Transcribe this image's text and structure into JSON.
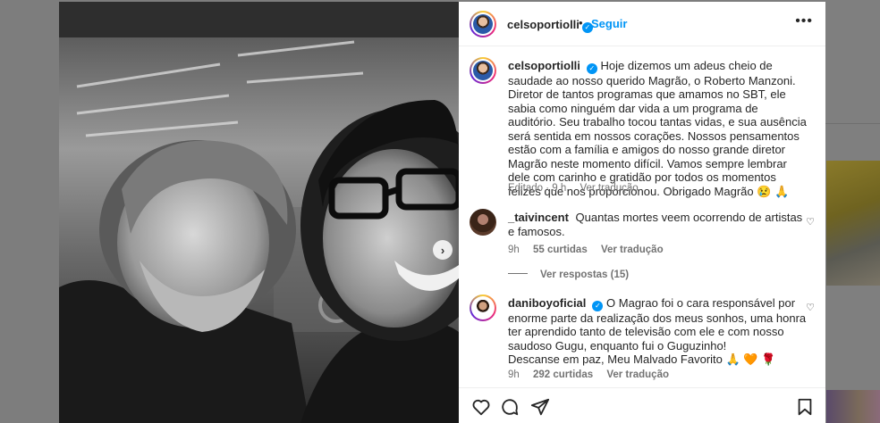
{
  "post": {
    "author": "celsoportiolli",
    "follow_label": "Seguir",
    "caption": "Hoje dizemos um adeus cheio de saudade ao nosso querido Magrão, o Roberto Manzoni. Diretor de tantos programas que amamos no SBT, ele sabia como ninguém dar vida a um programa de auditório. Seu trabalho tocou tantas vidas, e sua ausência será sentida em nossos corações. Nossos pensamentos estão com a família e amigos do nosso grande diretor Magrão neste momento difícil. Vamos sempre lembrar dele com carinho e gratidão por todos os momentos felizes que nos proporcionou. Obrigado Magrão 😢 🙏",
    "edited": "Editado",
    "time": "9 h",
    "see_translation": "Ver tradução"
  },
  "comments": [
    {
      "user": "_taivincent",
      "text": "Quantas mortes veem ocorrendo de artistas e famosos.",
      "time": "9h",
      "likes": "55 curtidas",
      "translate": "Ver tradução",
      "replies": "Ver respostas (15)"
    },
    {
      "user": "daniboyoficial",
      "text": "O Magrao foi o cara responsável por enorme parte da realização dos meus sonhos, uma honra ter aprendido tanto de televisão com ele e com nosso saudoso Gugu, enquanto fui o Guguzinho!",
      "text2": "Descanse em paz, Meu Malvado Favorito 🙏 🧡 🌹",
      "time": "9h",
      "likes": "292 curtidas",
      "translate": "Ver tradução"
    }
  ],
  "icons": {
    "more": "more-options-icon",
    "like": "heart-icon",
    "comment": "comment-icon",
    "share": "send-icon",
    "save": "bookmark-icon",
    "next": "chevron-right-icon"
  }
}
